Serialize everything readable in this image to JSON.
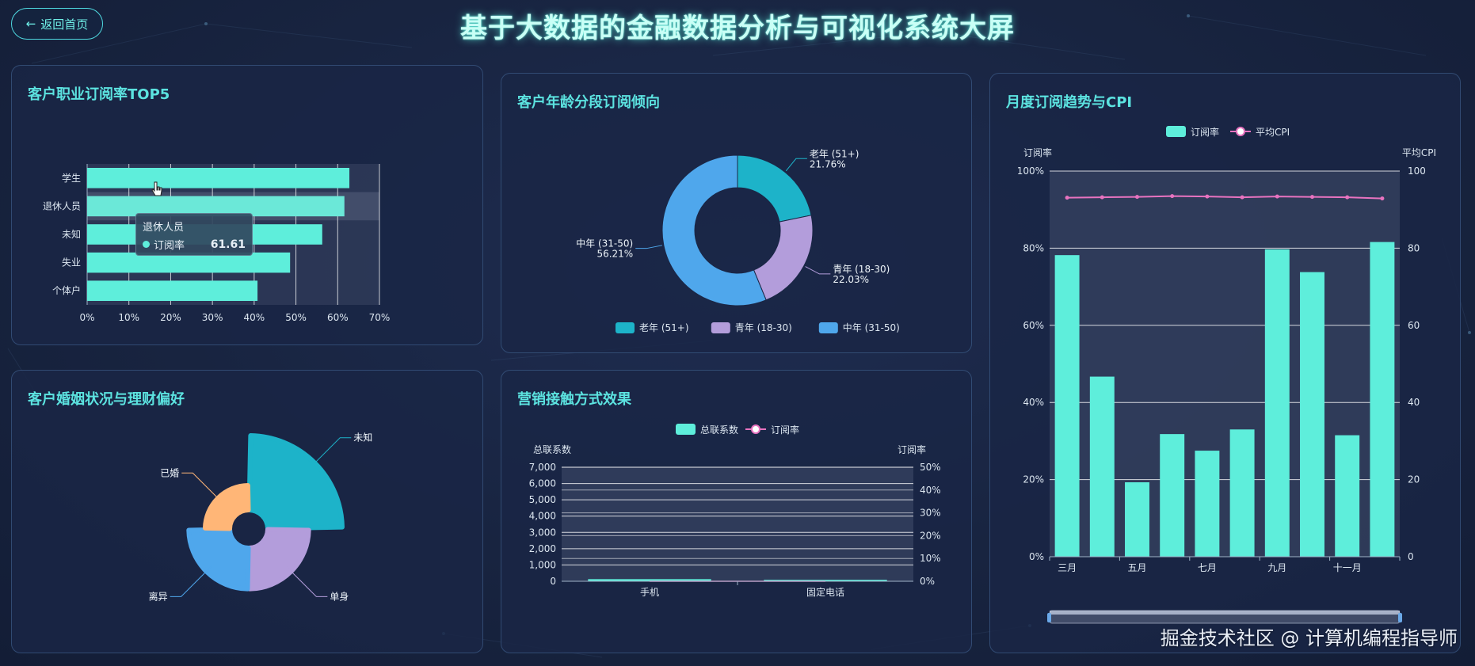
{
  "header": {
    "back_label": "返回首页",
    "title": "基于大数据的金融数据分析与可视化系统大屏"
  },
  "watermark": "掘金技术社区 @ 计算机编程指导师",
  "colors": {
    "accent": "#5ce3e0",
    "bar": "#5eeedb",
    "teal": "#1db3c9",
    "purple": "#b39ddb",
    "blue": "#4fa7ec",
    "orange": "#ffb677",
    "cpi_line": "#e873c0"
  },
  "panels": {
    "occupation": {
      "title": "客户职业订阅率TOP5",
      "tooltip": {
        "title": "退休人员",
        "series": "订阅率",
        "value": "61.61"
      }
    },
    "age": {
      "title": "客户年龄分段订阅倾向"
    },
    "monthly": {
      "title": "月度订阅趋势与CPI"
    },
    "marital": {
      "title": "客户婚姻状况与理财偏好"
    },
    "marketing": {
      "title": "营销接触方式效果"
    }
  },
  "chart_data": [
    {
      "id": "occupation",
      "type": "bar",
      "orientation": "horizontal",
      "categories": [
        "学生",
        "退休人员",
        "未知",
        "失业",
        "个体户"
      ],
      "values": [
        62.8,
        61.61,
        56.3,
        48.6,
        40.8
      ],
      "xlim": [
        0,
        70
      ],
      "x_ticks": [
        "0%",
        "10%",
        "20%",
        "30%",
        "40%",
        "50%",
        "60%",
        "70%"
      ]
    },
    {
      "id": "age",
      "type": "pie",
      "donut": true,
      "slices": [
        {
          "name": "老年 (51+)",
          "value": 21.76,
          "label": "老年 (51+)",
          "pct_label": "21.76%",
          "color": "#1db3c9"
        },
        {
          "name": "青年 (18-30)",
          "value": 22.03,
          "label": "青年 (18-30)",
          "pct_label": "22.03%",
          "color": "#b39ddb"
        },
        {
          "name": "中年 (31-50)",
          "value": 56.21,
          "label": "中年 (31-50)",
          "pct_label": "56.21%",
          "color": "#4fa7ec"
        }
      ],
      "legend": [
        "老年 (51+)",
        "青年 (18-30)",
        "中年 (31-50)"
      ]
    },
    {
      "id": "monthly",
      "type": "bar",
      "legend": [
        "订阅率",
        "平均CPI"
      ],
      "y_left_label": "订阅率",
      "y_right_label": "平均CPI",
      "y_left_ticks": [
        "0%",
        "20%",
        "40%",
        "60%",
        "80%",
        "100%"
      ],
      "y_right_ticks": [
        "0",
        "20",
        "40",
        "60",
        "80",
        "100"
      ],
      "x_tick_labels": [
        "三月",
        "五月",
        "七月",
        "九月",
        "十一月"
      ],
      "x_tick_positions": [
        0,
        2,
        4,
        6,
        8
      ],
      "series": [
        {
          "name": "订阅率",
          "type": "bar",
          "values": [
            78.2,
            46.7,
            19.3,
            31.8,
            27.5,
            33.0,
            79.7,
            73.8,
            31.5,
            81.6
          ]
        },
        {
          "name": "平均CPI",
          "type": "line",
          "values": [
            93.1,
            93.2,
            93.3,
            93.5,
            93.4,
            93.2,
            93.4,
            93.3,
            93.2,
            92.9
          ]
        }
      ],
      "ylim_left": [
        0,
        100
      ],
      "ylim_right": [
        0,
        100
      ]
    },
    {
      "id": "marital",
      "type": "pie",
      "rose": true,
      "slices": [
        {
          "name": "未知",
          "value": 100,
          "color": "#1db3c9"
        },
        {
          "name": "单身",
          "value": 55,
          "color": "#b39ddb"
        },
        {
          "name": "离异",
          "value": 55,
          "color": "#4fa7ec"
        },
        {
          "name": "已婚",
          "value": 33,
          "color": "#ffb677"
        }
      ]
    },
    {
      "id": "marketing",
      "type": "bar",
      "legend": [
        "总联系数",
        "订阅率"
      ],
      "y_left_label": "总联系数",
      "y_right_label": "订阅率",
      "categories": [
        "手机",
        "固定电话"
      ],
      "y_left_ticks": [
        "0",
        "1,000",
        "2,000",
        "3,000",
        "4,000",
        "5,000",
        "6,000",
        "7,000"
      ],
      "y_right_ticks": [
        "0%",
        "10%",
        "20%",
        "30%",
        "40%",
        "50%"
      ],
      "series": [
        {
          "name": "总联系数",
          "type": "bar",
          "values": [
            130,
            90
          ]
        },
        {
          "name": "订阅率",
          "type": "line",
          "values": [
            0,
            0
          ]
        }
      ],
      "ylim_left": [
        0,
        7000
      ],
      "ylim_right": [
        0,
        50
      ]
    }
  ]
}
